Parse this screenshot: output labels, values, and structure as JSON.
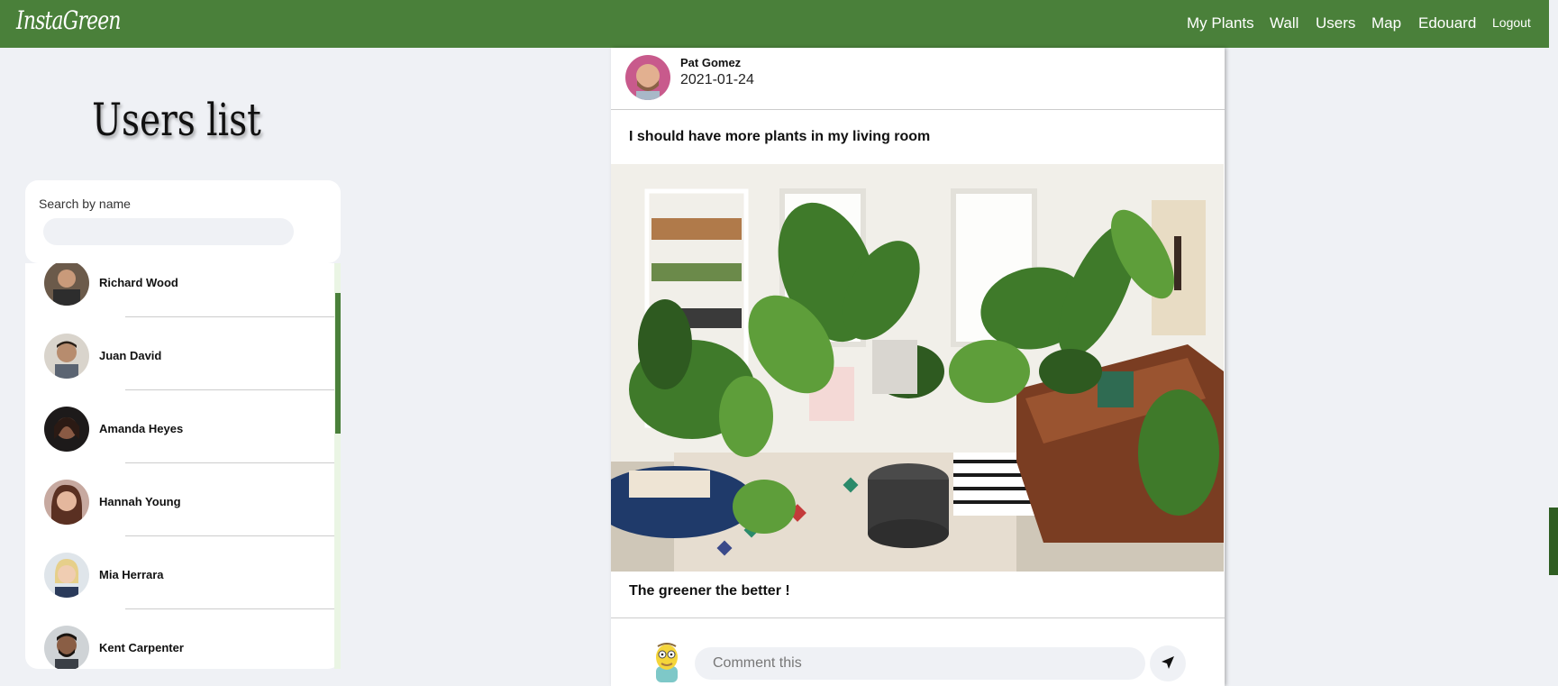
{
  "navbar": {
    "brand": "InstaGreen",
    "links": [
      "My Plants",
      "Wall",
      "Users",
      "Map",
      "Edouard"
    ],
    "logout": "Logout"
  },
  "users_page": {
    "title": "Users list",
    "search_label": "Search by name",
    "search_value": "",
    "users": [
      {
        "name": "Richard Wood"
      },
      {
        "name": "Juan David"
      },
      {
        "name": "Amanda Heyes"
      },
      {
        "name": "Hannah Young"
      },
      {
        "name": "Mia Herrara"
      },
      {
        "name": "Kent Carpenter"
      }
    ]
  },
  "post": {
    "author": "Pat Gomez",
    "date": "2021-01-24",
    "text": "I should have more plants in my living room",
    "caption": "The greener the better !",
    "comment_placeholder": "Comment this"
  },
  "colors": {
    "accent": "#4a803a",
    "background": "#eff1f5"
  },
  "icons": {
    "send": "paper-plane-icon"
  }
}
